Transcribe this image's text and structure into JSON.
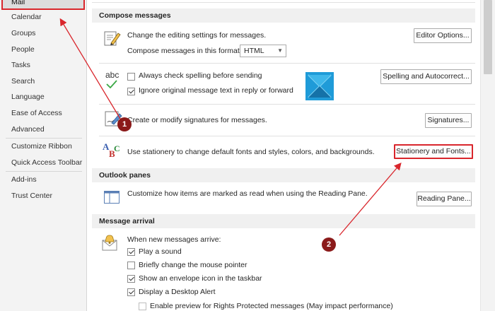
{
  "sidebar": {
    "items": [
      {
        "label": "Mail"
      },
      {
        "label": "Calendar"
      },
      {
        "label": "Groups"
      },
      {
        "label": "People"
      },
      {
        "label": "Tasks"
      },
      {
        "label": "Search"
      },
      {
        "label": "Language"
      },
      {
        "label": "Ease of Access"
      },
      {
        "label": "Advanced"
      },
      {
        "label": "Customize Ribbon"
      },
      {
        "label": "Quick Access Toolbar"
      },
      {
        "label": "Add-ins"
      },
      {
        "label": "Trust Center"
      }
    ],
    "selected": "Mail"
  },
  "compose": {
    "header": "Compose messages",
    "editing_text": "Change the editing settings for messages.",
    "editor_options_button": "Editor Options...",
    "format_label": "Compose messages in this format:",
    "format_value": "HTML",
    "always_check_spelling": "Always check spelling before sending",
    "ignore_original": "Ignore original message text in reply or forward",
    "spelling_button": "Spelling and Autocorrect...",
    "signatures_text": "Create or modify signatures for messages.",
    "signatures_button": "Signatures...",
    "stationery_text": "Use stationery to change default fonts and styles, colors, and backgrounds.",
    "stationery_button": "Stationery and Fonts...",
    "abc_icon_text": "abc"
  },
  "outlook_panes": {
    "header": "Outlook panes",
    "reading_text": "Customize how items are marked as read when using the Reading Pane.",
    "reading_button": "Reading Pane..."
  },
  "message_arrival": {
    "header": "Message arrival",
    "when_text": "When new messages arrive:",
    "options": [
      {
        "label": "Play a sound",
        "checked": true
      },
      {
        "label": "Briefly change the mouse pointer",
        "checked": false
      },
      {
        "label": "Show an envelope icon in the taskbar",
        "checked": true
      },
      {
        "label": "Display a Desktop Alert",
        "checked": true
      }
    ],
    "rights_protected": "Enable preview for Rights Protected messages (May impact performance)"
  },
  "annotations": {
    "badge1": "1",
    "badge2": "2"
  },
  "colors": {
    "annotation_red": "#d9262c",
    "badge": "#8b1a1a",
    "logo_teal": "#1f9bd8"
  }
}
